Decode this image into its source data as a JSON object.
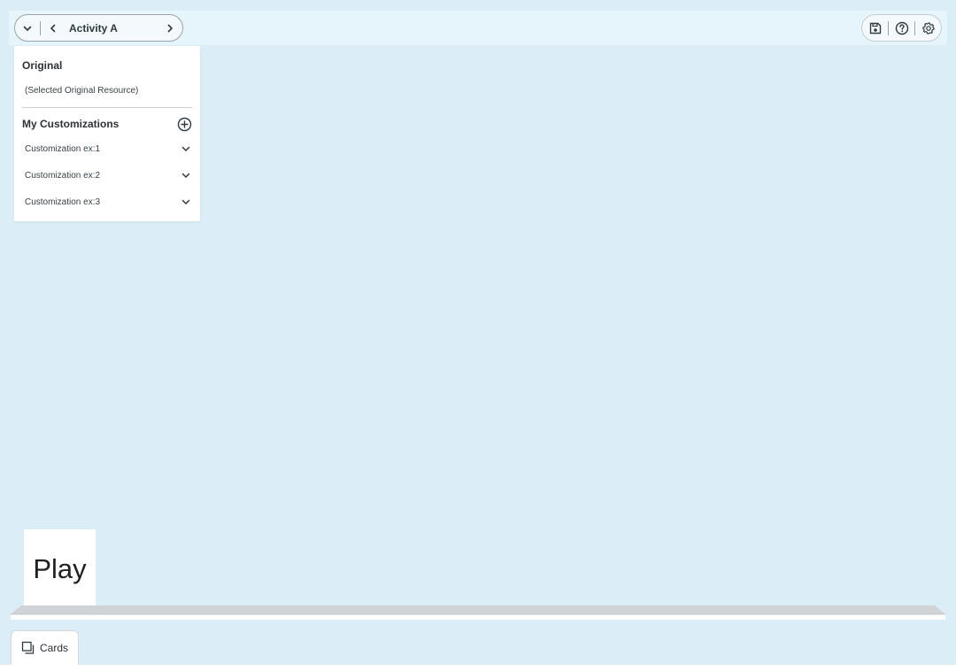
{
  "header": {
    "activity_title": "Activity A",
    "icons": {
      "dropdown": "chevron-down-icon",
      "prev": "chevron-left-icon",
      "next": "chevron-right-icon",
      "save": "save-icon",
      "help": "help-icon",
      "settings": "gear-icon"
    }
  },
  "dropdown": {
    "original_title": "Original",
    "original_item": "(Selected Original Resource)",
    "customizations_title": "My Customizations",
    "customizations": [
      {
        "label": "Customization ex:1"
      },
      {
        "label": "Customization ex:2"
      },
      {
        "label": "Customization ex:3"
      }
    ]
  },
  "stage": {
    "play_label": "Play"
  },
  "footer": {
    "cards_label": "Cards"
  },
  "colors": {
    "background": "#dbeef8",
    "top_strip": "#e6f4fb",
    "panel": "#ffffff"
  }
}
